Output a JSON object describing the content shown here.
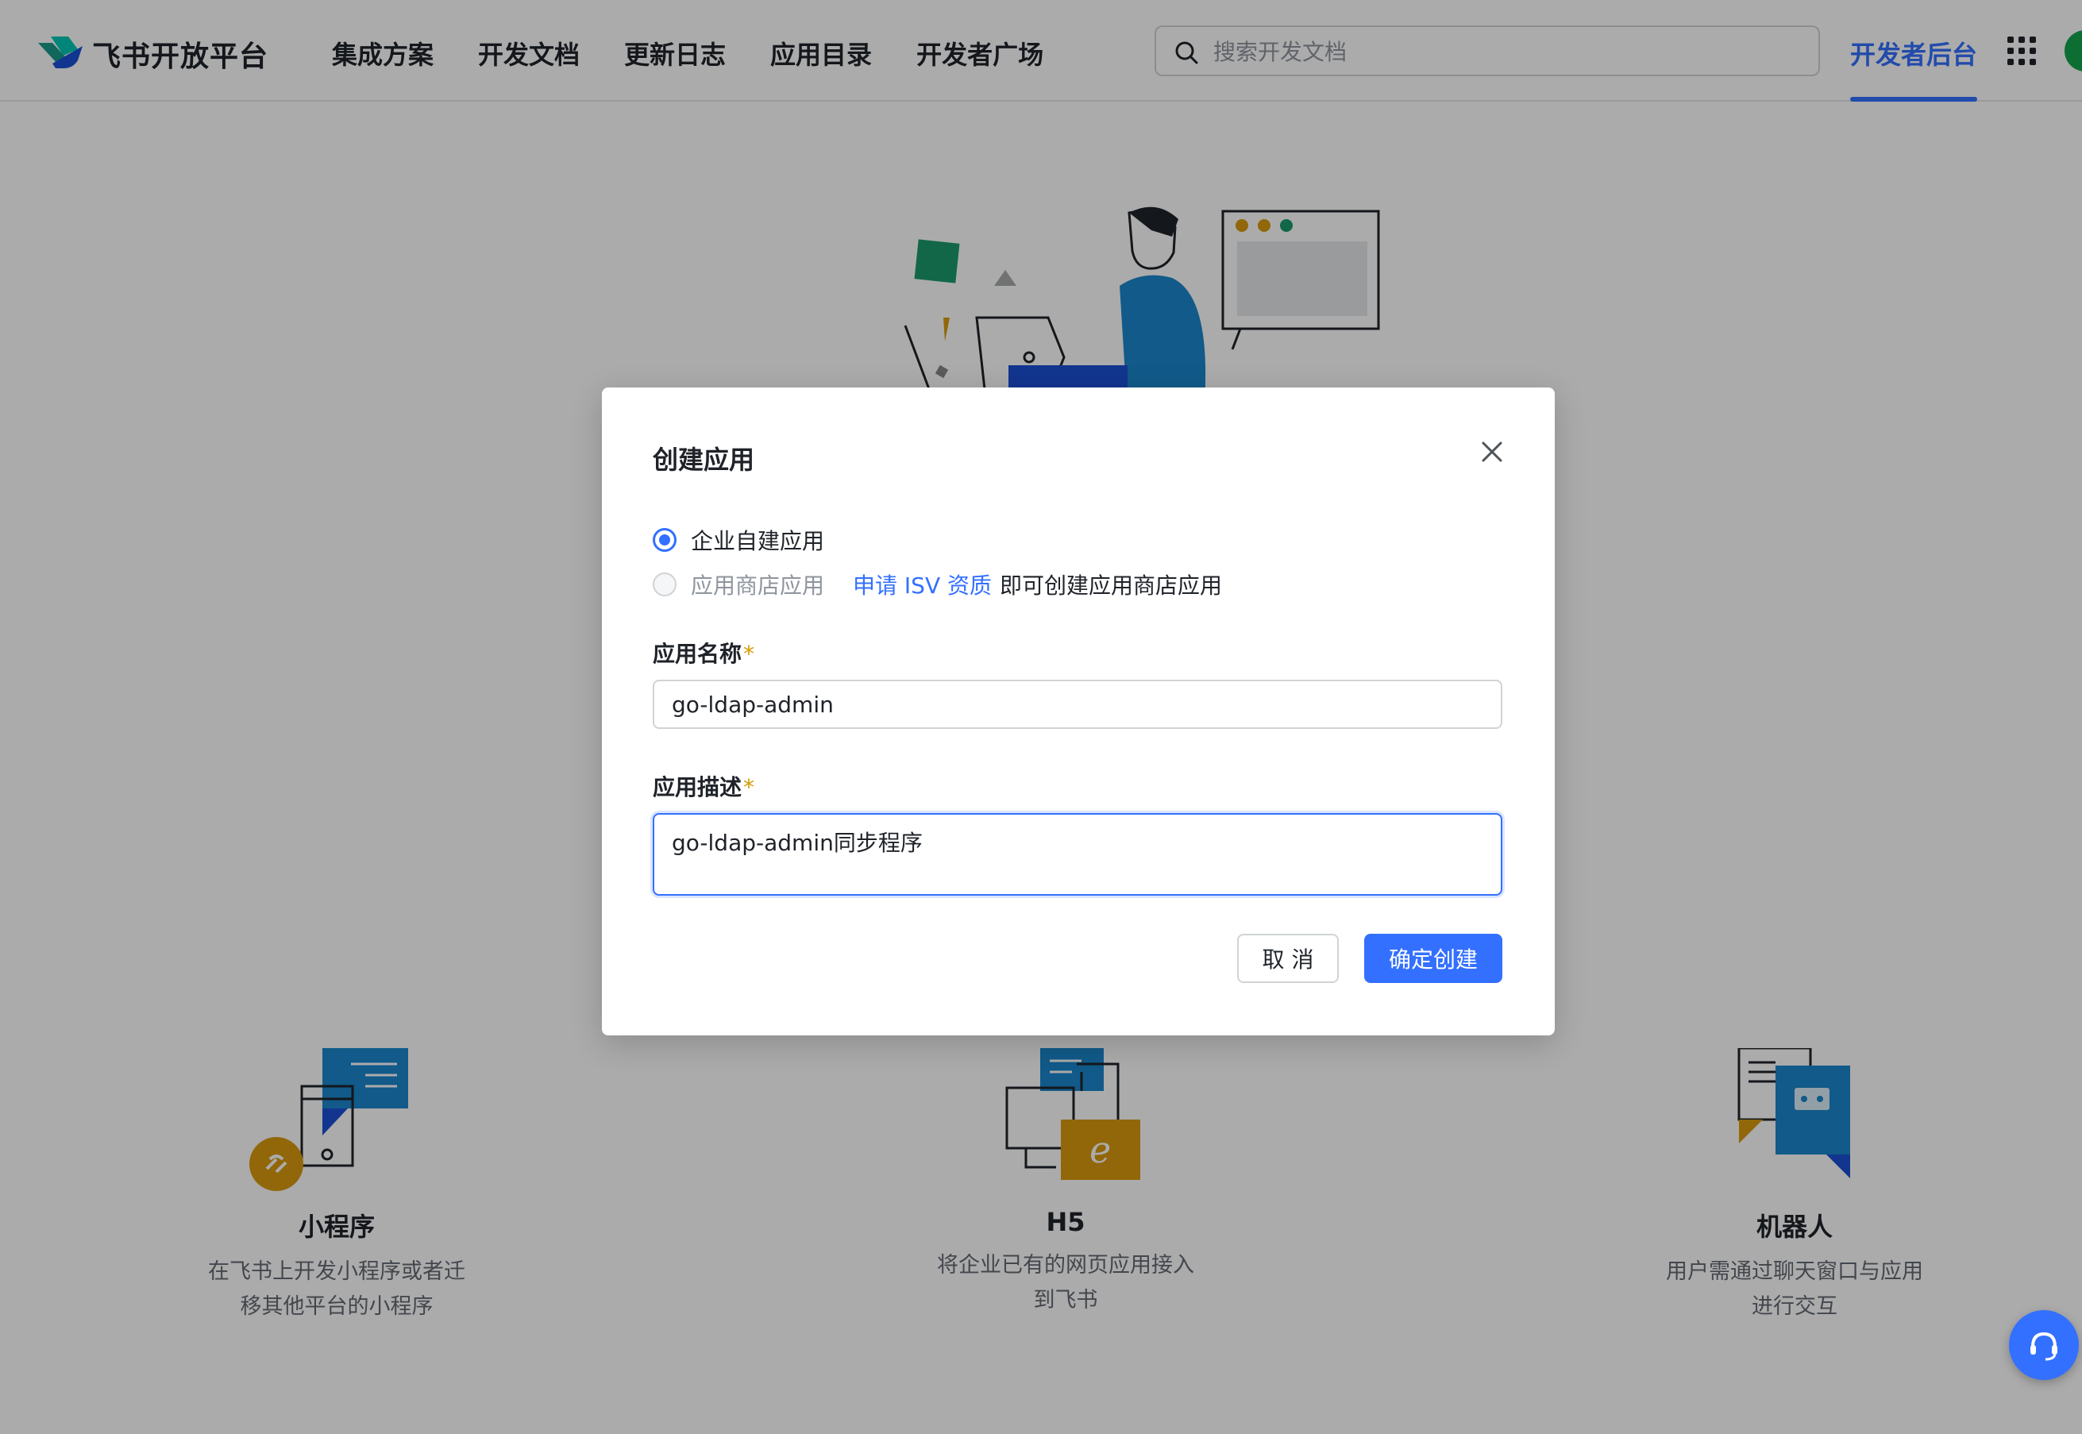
{
  "header": {
    "brand": "飞书开放平台",
    "nav": [
      "集成方案",
      "开发文档",
      "更新日志",
      "应用目录",
      "开发者广场"
    ],
    "search_placeholder": "搜索开发文档",
    "dev_console": "开发者后台"
  },
  "cards": [
    {
      "title": "小程序",
      "desc_line1": "在飞书上开发小程序或者迁",
      "desc_line2": "移其他平台的小程序"
    },
    {
      "title": "H5",
      "desc_line1": "将企业已有的网页应用接入",
      "desc_line2": "到飞书"
    },
    {
      "title": "机器人",
      "desc_line1": "用户需通过聊天窗口与应用",
      "desc_line2": "进行交互"
    }
  ],
  "modal": {
    "title": "创建应用",
    "radio_enterprise": "企业自建应用",
    "radio_store": "应用商店应用",
    "isv_link": "申请 ISV 资质",
    "isv_rest": "即可创建应用商店应用",
    "name_label": "应用名称",
    "name_value": "go-ldap-admin",
    "desc_label": "应用描述",
    "desc_value": "go-ldap-admin同步程序",
    "required_mark": "*",
    "cancel": "取 消",
    "confirm": "确定创建"
  },
  "colors": {
    "primary": "#3370ff",
    "required": "#d69a00",
    "illustration_blue": "#1a86cc",
    "illustration_gold": "#d99a0e",
    "illustration_green": "#1b9a6e"
  },
  "icons": {
    "search": "search-icon",
    "apps": "apps-grid-icon",
    "close": "close-icon",
    "support": "headset-icon"
  }
}
